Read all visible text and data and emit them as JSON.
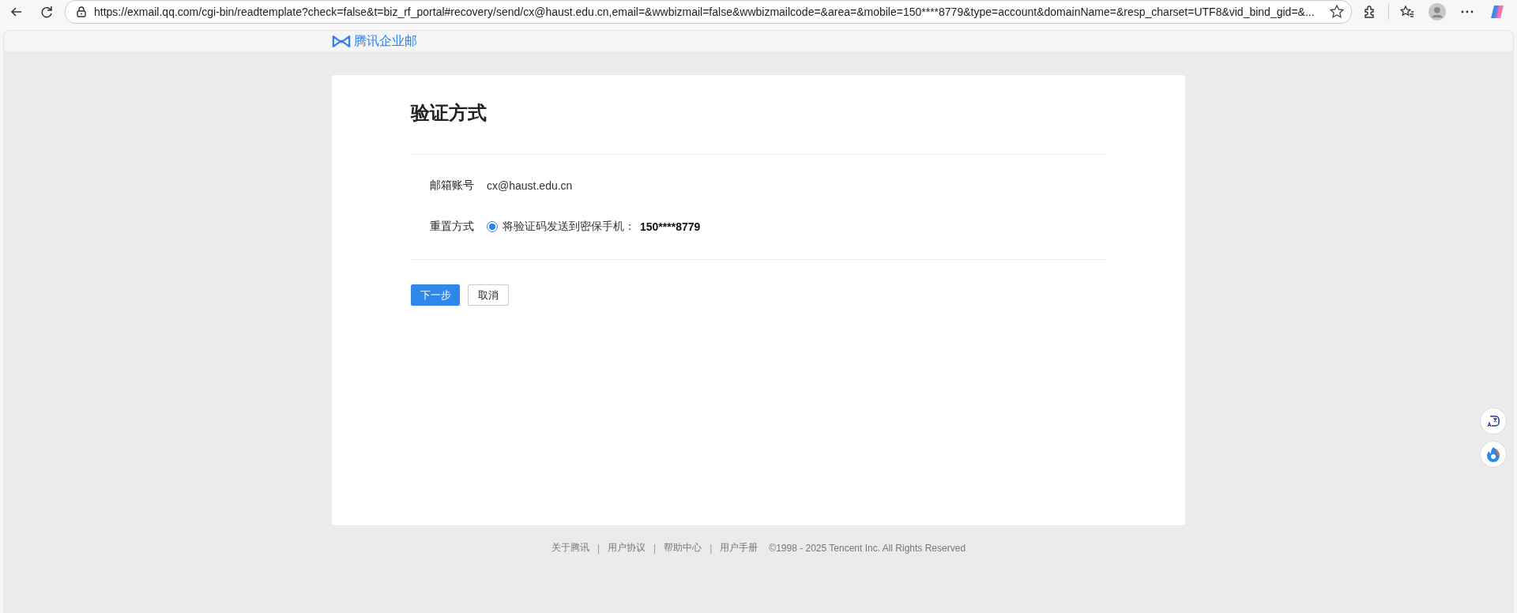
{
  "browser": {
    "url": "https://exmail.qq.com/cgi-bin/readtemplate?check=false&t=biz_rf_portal#recovery/send/cx@haust.edu.cn,email=&wwbizmail=false&wwbizmailcode=&area=&mobile=150****8779&type=account&domainName=&resp_charset=UTF8&vid_bind_gid=&..."
  },
  "header": {
    "brand": "腾讯企业邮"
  },
  "card": {
    "title": "验证方式",
    "fields": [
      {
        "kind": "text",
        "label": "邮箱账号",
        "value": "cx@haust.edu.cn"
      },
      {
        "kind": "radio",
        "label": "重置方式",
        "option": "将验证码发送到密保手机：",
        "phone": "150****8779",
        "selected": true
      }
    ],
    "buttons": [
      {
        "kind": "primary",
        "label": "下一步"
      },
      {
        "kind": "secondary",
        "label": "取消"
      }
    ]
  },
  "footer": {
    "items": [
      {
        "kind": "link",
        "text": "关于腾讯"
      },
      {
        "kind": "separator",
        "text": "|"
      },
      {
        "kind": "link",
        "text": "用户协议"
      },
      {
        "kind": "separator",
        "text": "|"
      },
      {
        "kind": "link",
        "text": "帮助中心"
      },
      {
        "kind": "separator",
        "text": "|"
      },
      {
        "kind": "link",
        "text": "用户手册"
      }
    ],
    "copyright": "©1998 - 2025 Tencent Inc. All Rights Reserved"
  }
}
